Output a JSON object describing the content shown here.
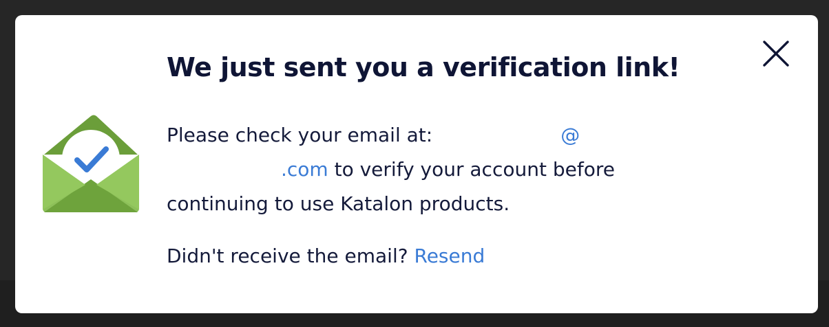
{
  "dialog": {
    "title": "We just sent you a verification link!",
    "message_prefix": "Please check your email at:",
    "email_at": "@",
    "email_tld": ".com",
    "message_suffix": " to verify your account before continuing to use Katalon products.",
    "resend_prompt": "Didn't receive the email?",
    "resend_label": "Resend",
    "close_icon": "close-icon",
    "envelope_icon": "envelope-check-icon"
  },
  "colors": {
    "title": "#0f1535",
    "link": "#3a7bd5",
    "envelope_dark": "#6b9e3a",
    "envelope_light": "#8dc05a",
    "check": "#3a7bd5"
  }
}
